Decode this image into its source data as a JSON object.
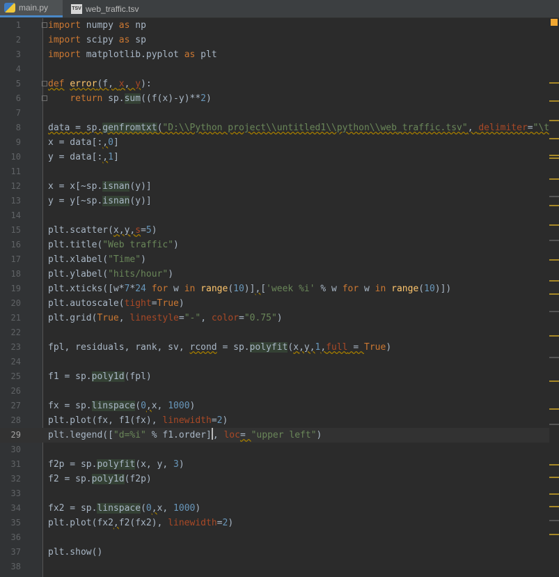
{
  "tabs": [
    {
      "label": "main.py",
      "icon": "python-file-icon",
      "active": true
    },
    {
      "label": "web_traffic.tsv",
      "icon": "tsv-file-icon",
      "active": false
    }
  ],
  "editor": {
    "current_line": 29,
    "lines": [
      {
        "n": "1"
      },
      {
        "n": "2"
      },
      {
        "n": "3"
      },
      {
        "n": "4"
      },
      {
        "n": "5"
      },
      {
        "n": "6"
      },
      {
        "n": "7"
      },
      {
        "n": "8"
      },
      {
        "n": "9"
      },
      {
        "n": "10"
      },
      {
        "n": "11"
      },
      {
        "n": "12"
      },
      {
        "n": "13"
      },
      {
        "n": "14"
      },
      {
        "n": "15"
      },
      {
        "n": "16"
      },
      {
        "n": "17"
      },
      {
        "n": "18"
      },
      {
        "n": "19"
      },
      {
        "n": "20"
      },
      {
        "n": "21"
      },
      {
        "n": "22"
      },
      {
        "n": "23"
      },
      {
        "n": "24"
      },
      {
        "n": "25"
      },
      {
        "n": "26"
      },
      {
        "n": "27"
      },
      {
        "n": "28"
      },
      {
        "n": "29"
      },
      {
        "n": "30"
      },
      {
        "n": "31"
      },
      {
        "n": "32"
      },
      {
        "n": "33"
      },
      {
        "n": "34"
      },
      {
        "n": "35"
      },
      {
        "n": "36"
      },
      {
        "n": "37"
      },
      {
        "n": "38"
      }
    ],
    "tokens": {
      "l1": [
        "import numpy as np"
      ],
      "l2": [
        "import",
        " scipy ",
        "as",
        " sp"
      ],
      "l3": [
        "import",
        " matplotlib.pyplot ",
        "as",
        " plt"
      ],
      "l5": [
        "def",
        " ",
        "error",
        "(f, ",
        "x",
        ", ",
        "y",
        "):"
      ],
      "l6": [
        "    ",
        "return",
        " sp.",
        "sum",
        "((f(x)-y)**",
        "2",
        ")"
      ],
      "l8": [
        "data = sp.",
        "genfromtxt",
        "(",
        "\"D:\\\\Python project\\\\untitled1\\\\python\\\\web_traffic.tsv\"",
        ", ",
        "delimiter",
        "=",
        "\"\\t"
      ],
      "l9": [
        "x = data[:",
        ",",
        "0",
        "]"
      ],
      "l10": [
        "y = data[:",
        ",",
        "1",
        "]"
      ],
      "l12": [
        "x = x[~sp.",
        "isnan",
        "(y)]"
      ],
      "l13": [
        "y = y[~sp.",
        "isnan",
        "(y)]"
      ],
      "l15": [
        "plt.scatter(",
        "x",
        ",",
        "y",
        ",",
        "s",
        "=",
        "5",
        ")"
      ],
      "l16": [
        "plt.title(",
        "\"Web traffic\"",
        ")"
      ],
      "l17": [
        "plt.xlabel(",
        "\"Time\"",
        ")"
      ],
      "l18": [
        "plt.ylabel(",
        "\"hits/hour\"",
        ")"
      ],
      "l19": [
        "plt.xticks([w*",
        "7",
        "*",
        "24",
        " ",
        "for",
        " w ",
        "in",
        " ",
        "range",
        "(",
        "10",
        ")]",
        ",",
        "[",
        "'week %i'",
        " % w ",
        "for",
        " w ",
        "in",
        " ",
        "range",
        "(",
        "10",
        ")])"
      ],
      "l20": [
        "plt.autoscale(",
        "tight",
        "=",
        "True",
        ")"
      ],
      "l21": [
        "plt.grid(",
        "True",
        ", ",
        "linestyle",
        "=",
        "\"-\"",
        ", ",
        "color",
        "=",
        "\"0.75\"",
        ")"
      ],
      "l23": [
        "fpl, residuals, rank, sv, ",
        "rcond",
        " = sp.",
        "polyfit",
        "(",
        "x",
        ",",
        "y",
        ",",
        "1",
        ",",
        "full",
        " = ",
        "True",
        ")"
      ],
      "l25": [
        "f1 = sp.",
        "poly1d",
        "(fpl)"
      ],
      "l27": [
        "fx = sp.",
        "linspace",
        "(",
        "0",
        ",",
        "x, ",
        "1000",
        ")"
      ],
      "l28": [
        "plt.plot(fx, f1(fx), ",
        "linewidth",
        "=",
        "2",
        ")"
      ],
      "l29": [
        "plt.legend([",
        "\"d=%i\"",
        " % f1.order]",
        ",",
        " ",
        "loc",
        "= ",
        "\"upper left\"",
        ")"
      ],
      "l31": [
        "f2p = sp.",
        "polyfit",
        "(x, y, ",
        "3",
        ")"
      ],
      "l32": [
        "f2 = sp.",
        "poly1d",
        "(f2p)"
      ],
      "l34": [
        "fx2 = sp.",
        "linspace",
        "(",
        "0",
        ",",
        "x, ",
        "1000",
        ")"
      ],
      "l35": [
        "plt.plot(fx2",
        ",",
        "f2(fx2), ",
        "linewidth",
        "=",
        "2",
        ")"
      ],
      "l37": [
        "plt.show()"
      ]
    }
  },
  "colors": {
    "background": "#2b2b2b",
    "keyword": "#cc7832",
    "function": "#ffc66d",
    "string": "#6a8759",
    "number": "#6897bb",
    "param": "#aa4926",
    "text": "#a9b7c6"
  }
}
